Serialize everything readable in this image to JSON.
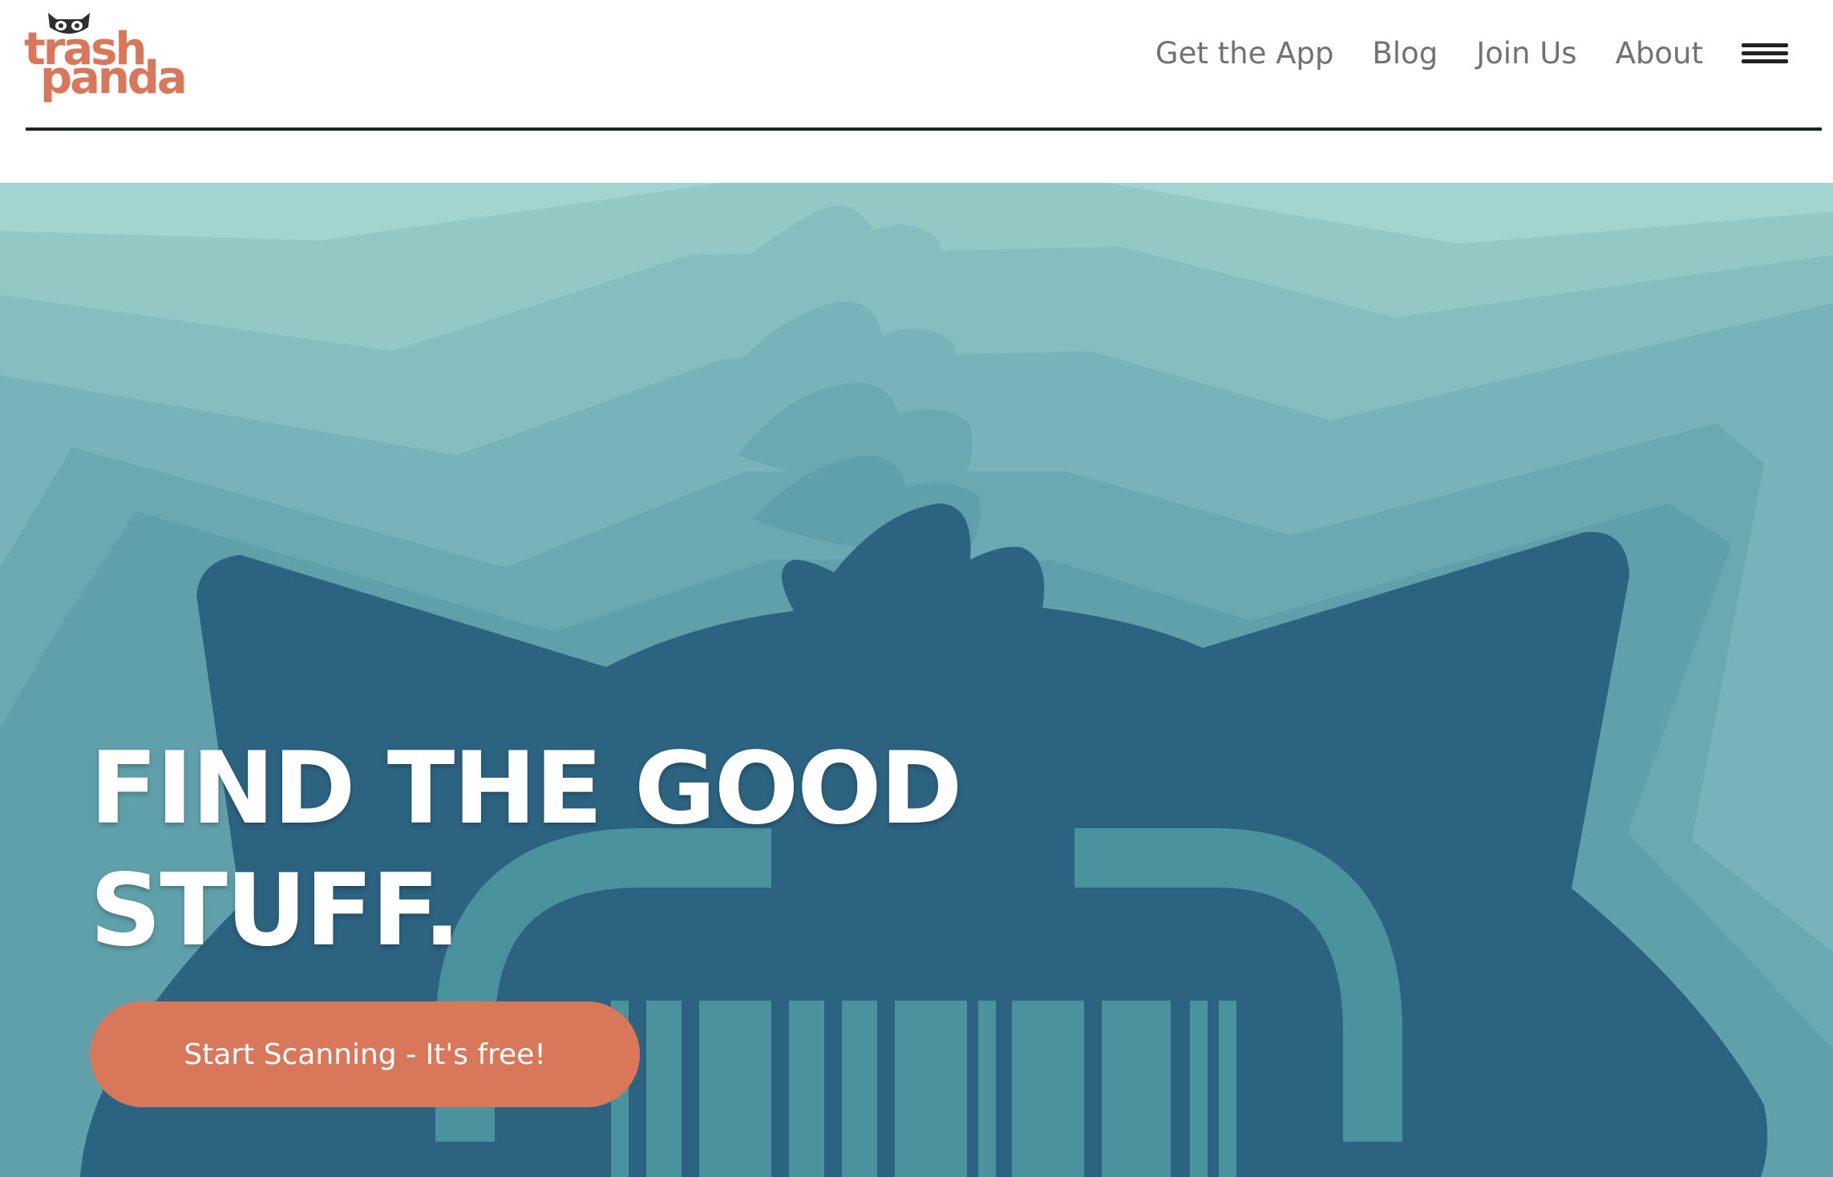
{
  "logo": {
    "line1": "trash",
    "line2": "panda"
  },
  "nav": {
    "items": [
      {
        "label": "Get the App"
      },
      {
        "label": "Blog"
      },
      {
        "label": "Join Us"
      },
      {
        "label": "About"
      }
    ],
    "menu_icon": "hamburger-menu-icon"
  },
  "hero": {
    "headline_line1": "FIND THE GOOD",
    "headline_line2": "STUFF.",
    "cta_label": "Start Scanning - It's free!"
  },
  "colors": {
    "brand_accent": "#d9775a",
    "hero_dark": "#2c6381",
    "hero_light": "#a2d4d0",
    "nav_text": "#6f7278"
  }
}
